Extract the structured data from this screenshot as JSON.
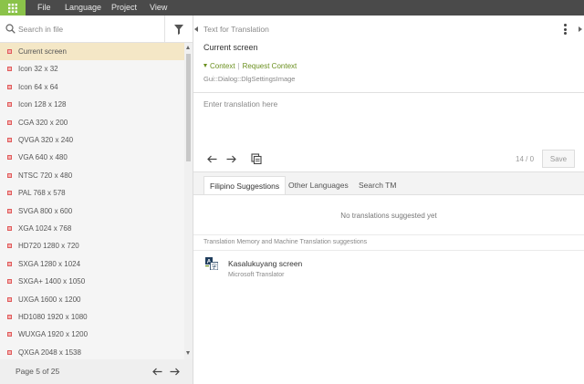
{
  "topbar": {
    "menu": [
      "File",
      "Language",
      "Project",
      "View"
    ]
  },
  "sidebar": {
    "search_placeholder": "Search in file",
    "items": [
      "Current screen",
      "Icon 32 x 32",
      "Icon 64 x 64",
      "Icon 128 x 128",
      "CGA 320 x 200",
      "QVGA 320 x 240",
      "VGA 640 x 480",
      "NTSC 720 x 480",
      "PAL 768 x 578",
      "SVGA 800 x 600",
      "XGA 1024 x 768",
      "HD720 1280 x 720",
      "SXGA 1280 x 1024",
      "SXGA+ 1400 x 1050",
      "UXGA 1600 x 1200",
      "HD1080 1920 x 1080",
      "WUXGA 1920 x 1200",
      "QXGA 2048 x 1538"
    ],
    "selected_index": 0,
    "pager": "Page 5 of 25"
  },
  "editor": {
    "source_heading": "Text for Translation",
    "source_text": "Current screen",
    "context_label": "Context",
    "request_context_label": "Request Context",
    "context_value": "Gui::Dialog::DlgSettingsImage",
    "translation_placeholder": "Enter translation here",
    "counter": "14 / 0",
    "save_label": "Save"
  },
  "suggestions": {
    "tabs": [
      "Filipino Suggestions",
      "Other Languages",
      "Search TM"
    ],
    "active_tab": 0,
    "empty_message": "No translations suggested yet",
    "tm_heading": "Translation Memory and Machine Translation suggestions",
    "mt_text": "Kasalukuyang screen",
    "mt_source": "Microsoft Translator"
  },
  "colors": {
    "accent": "#8bc34a",
    "topbar": "#4a4a4a",
    "selected_row": "#f4e7c6",
    "context_link": "#6a8f1e"
  }
}
